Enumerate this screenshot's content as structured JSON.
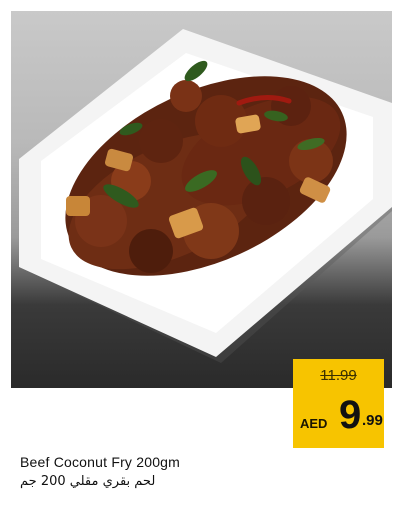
{
  "product": {
    "name_en": "Beef Coconut Fry 200gm",
    "name_ar": "لحم بقري مقلي 200 جم",
    "image_icon": "beef-coconut-fry-photo"
  },
  "price": {
    "old": "11.99",
    "currency": "AED",
    "integer": "9",
    "decimal": ".99"
  },
  "colors": {
    "price_tag": "#f7c400"
  }
}
